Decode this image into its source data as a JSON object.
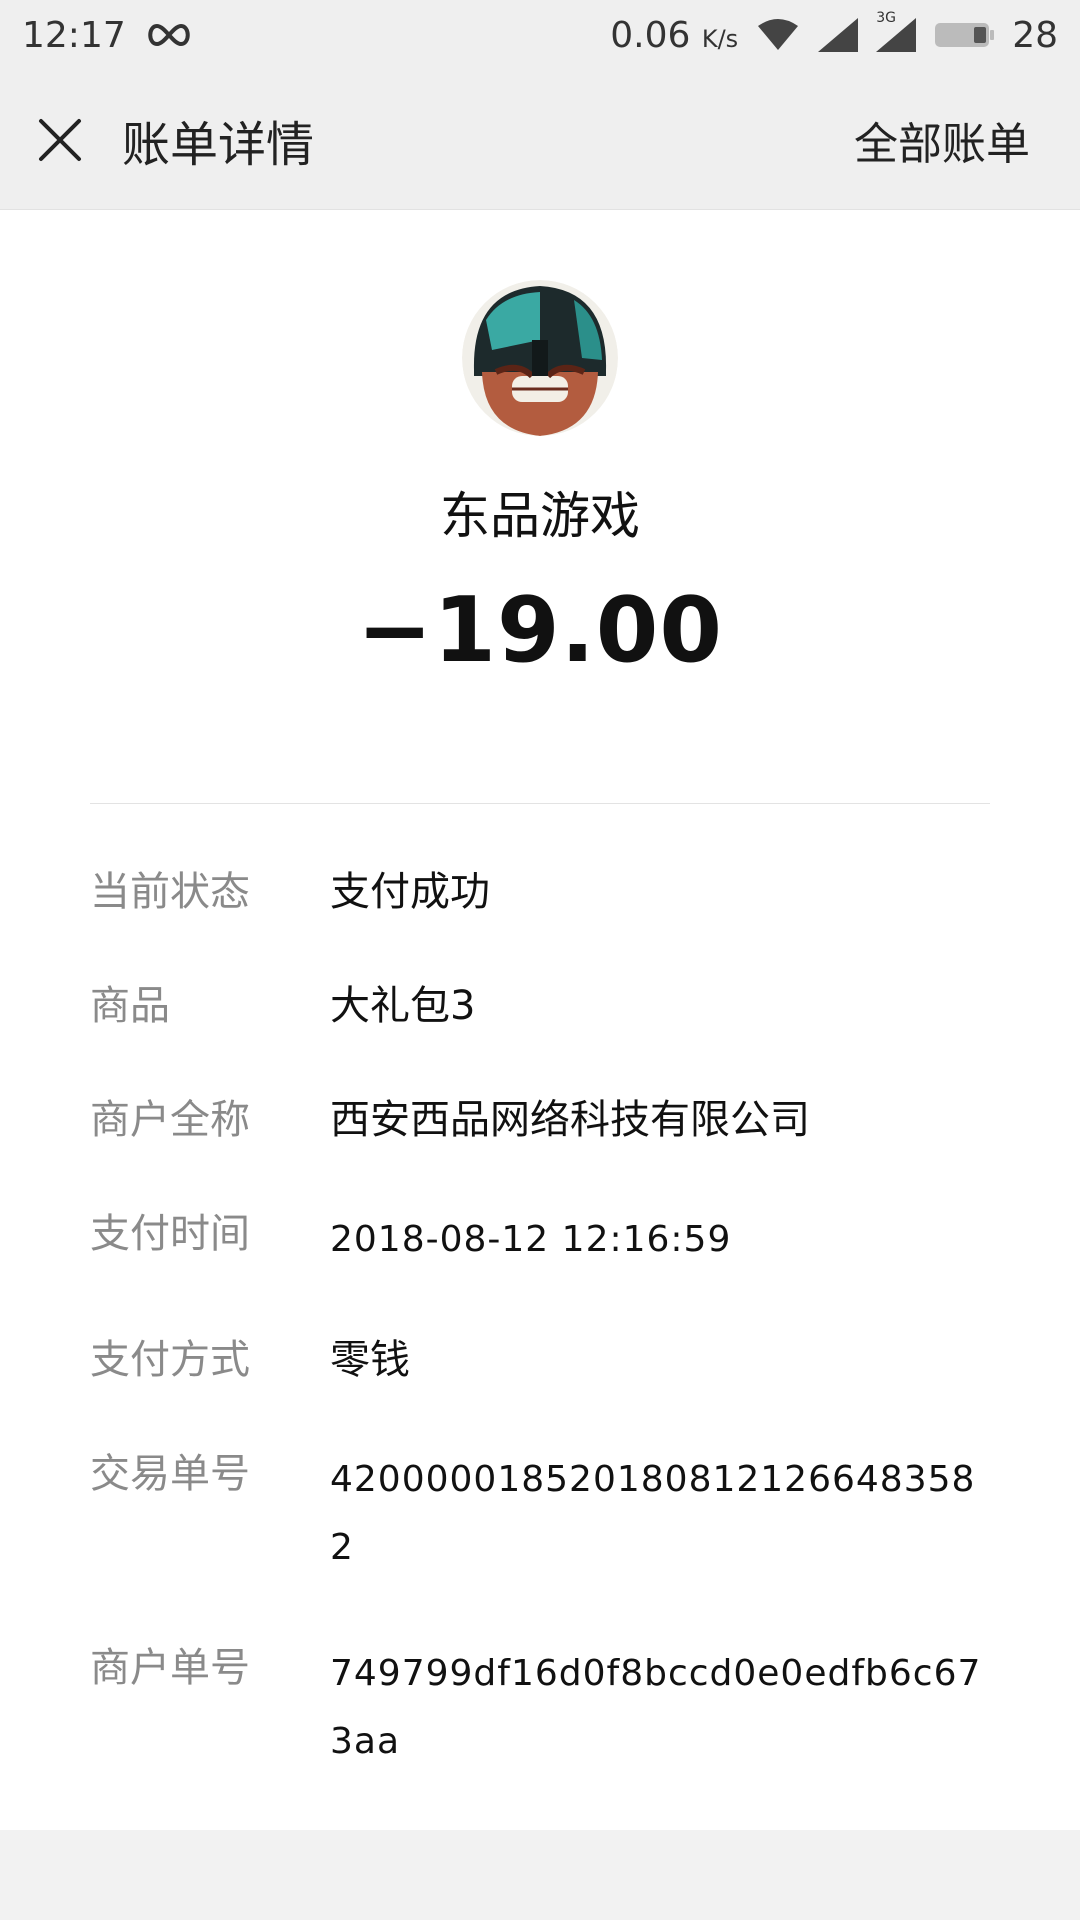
{
  "status_bar": {
    "time": "12:17",
    "speed": "0.06",
    "speed_unit": "K/s",
    "network": "3G",
    "battery": "28"
  },
  "header": {
    "title": "账单详情",
    "right_action": "全部账单"
  },
  "merchant": {
    "name": "东品游戏",
    "amount": "−19.00"
  },
  "details": [
    {
      "label": "当前状态",
      "value": "支付成功"
    },
    {
      "label": "商品",
      "value": "大礼包3"
    },
    {
      "label": "商户全称",
      "value": "西安西品网络科技有限公司"
    },
    {
      "label": "支付时间",
      "value": "2018-08-12 12:16:59"
    },
    {
      "label": "支付方式",
      "value": "零钱"
    },
    {
      "label": "交易单号",
      "value": "4200000185201808121266483582"
    },
    {
      "label": "商户单号",
      "value": "749799df16d0f8bccd0e0edfb6c673aa"
    }
  ]
}
